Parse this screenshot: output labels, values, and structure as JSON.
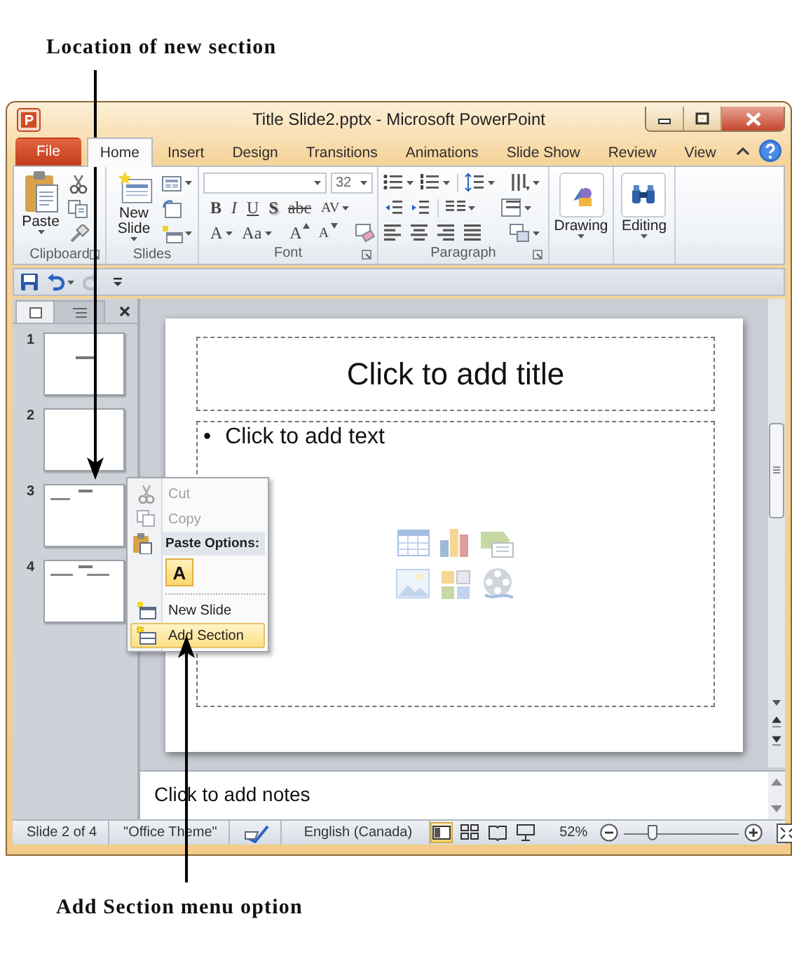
{
  "annotations": [
    {
      "kind": "top",
      "text": "Location of new section"
    },
    {
      "kind": "bottom",
      "text": "Add Section menu option"
    }
  ],
  "window": {
    "title": "Title Slide2.pptx - Microsoft PowerPoint"
  },
  "tabs": [
    {
      "kind": "file",
      "label": "File",
      "selected": false
    },
    {
      "kind": "tab",
      "label": "Home",
      "selected": true
    },
    {
      "kind": "tab",
      "label": "Insert",
      "selected": false
    },
    {
      "kind": "tab",
      "label": "Design",
      "selected": false
    },
    {
      "kind": "tab",
      "label": "Transitions",
      "selected": false
    },
    {
      "kind": "tab",
      "label": "Animations",
      "selected": false
    },
    {
      "kind": "tab",
      "label": "Slide Show",
      "selected": false
    },
    {
      "kind": "tab",
      "label": "Review",
      "selected": false
    },
    {
      "kind": "tab",
      "label": "View",
      "selected": false
    }
  ],
  "ribbon": {
    "clipboard": {
      "label": "Clipboard",
      "paste": "Paste"
    },
    "slides": {
      "label": "Slides",
      "new_slide": "New Slide"
    },
    "font": {
      "label": "Font",
      "size": "32",
      "format_buttons": [
        "B",
        "I",
        "U",
        "S",
        "abc",
        "AV"
      ],
      "size_buttons": [
        "A",
        "Aa",
        "A",
        "A"
      ]
    },
    "paragraph": {
      "label": "Paragraph"
    },
    "drawing": "Drawing",
    "editing": "Editing"
  },
  "quick_access": {
    "redo": {
      "disabled": true
    }
  },
  "slides_panel": {
    "slides": [
      {
        "number": "1",
        "kind": "title"
      },
      {
        "number": "2",
        "kind": "blank"
      },
      {
        "number": "3",
        "kind": "content"
      },
      {
        "number": "4",
        "kind": "comparison"
      }
    ]
  },
  "context_menu": {
    "items": [
      {
        "kind": "command",
        "label": "Cut",
        "disabled": true,
        "selected": false
      },
      {
        "kind": "command",
        "label": "Copy",
        "disabled": true,
        "selected": false
      },
      {
        "kind": "header",
        "label": "Paste Options:"
      },
      {
        "kind": "paste",
        "label": "A"
      },
      {
        "kind": "command",
        "label": "New Slide",
        "disabled": false,
        "selected": false
      },
      {
        "kind": "command",
        "label": "Add Section",
        "disabled": false,
        "selected": true
      }
    ]
  },
  "slide": {
    "title": "Click to add title",
    "bullet": "•",
    "body": "Click to add text"
  },
  "notes": {
    "text": "Click to add notes"
  },
  "status_bar": {
    "slide": "Slide 2 of 4",
    "theme": "\"Office Theme\"",
    "language": "English (Canada)",
    "views": [
      {
        "kind": "normal",
        "selected": true
      },
      {
        "kind": "sorter",
        "selected": false
      },
      {
        "kind": "reading",
        "selected": false
      },
      {
        "kind": "slideshow",
        "selected": false
      }
    ],
    "zoom": "52%",
    "zoom_slider": {
      "level": 0.24
    }
  }
}
